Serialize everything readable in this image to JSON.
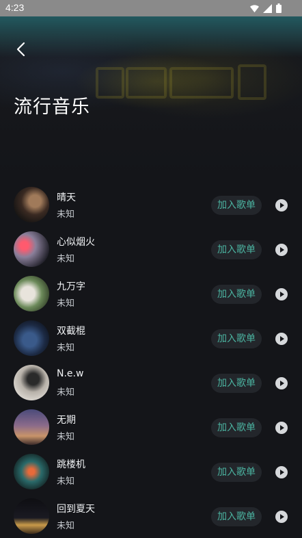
{
  "status_bar": {
    "time": "4:23"
  },
  "header": {
    "title": "流行音乐"
  },
  "colors": {
    "accent": "#4bb3a0",
    "background": "#141519"
  },
  "songs": [
    {
      "name": "晴天",
      "artist": "未知",
      "add_label": "加入歌单"
    },
    {
      "name": "心似烟火",
      "artist": "未知",
      "add_label": "加入歌单"
    },
    {
      "name": "九万字",
      "artist": "未知",
      "add_label": "加入歌单"
    },
    {
      "name": "双截棍",
      "artist": "未知",
      "add_label": "加入歌单"
    },
    {
      "name": "N.e.w",
      "artist": "未知",
      "add_label": "加入歌单"
    },
    {
      "name": "无期",
      "artist": "未知",
      "add_label": "加入歌单"
    },
    {
      "name": "跳楼机",
      "artist": "未知",
      "add_label": "加入歌单"
    },
    {
      "name": "回到夏天",
      "artist": "未知",
      "add_label": "加入歌单"
    }
  ]
}
